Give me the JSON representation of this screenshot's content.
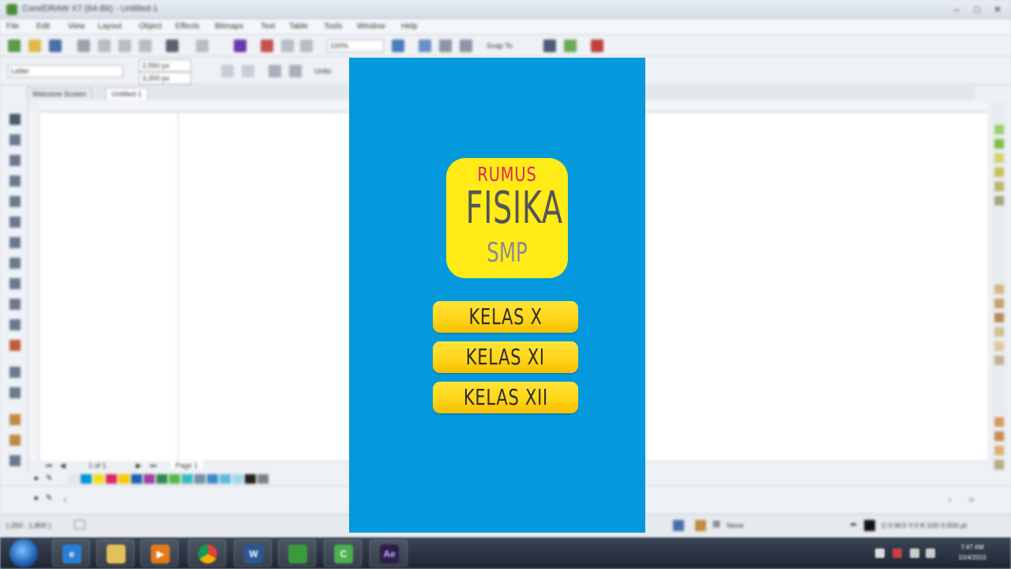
{
  "window": {
    "title": "CorelDRAW X7 (64-Bit) - Untitled-1"
  },
  "menu": [
    "File",
    "Edit",
    "View",
    "Layout",
    "Object",
    "Effects",
    "Bitmaps",
    "Text",
    "Table",
    "Tools",
    "Window",
    "Help"
  ],
  "toolbar": {
    "zoom_value": "100%",
    "snap_to_label": "Snap To"
  },
  "property_bar": {
    "page_size": "Letter",
    "width": "2,550 px",
    "height": "3,300 px",
    "units_label": "Units:"
  },
  "doc_tabs": [
    "Welcome Screen",
    "Untitled-1"
  ],
  "page_nav": {
    "page_count": "1 of 1",
    "page_tab": "Page 1"
  },
  "status": {
    "cursor_position": "(-250 , 1,800 )",
    "fill_label": "None",
    "color_info": "C:0 M:0 Y:0 K:100  0.500 pt"
  },
  "app_screen": {
    "logo": {
      "line1": "RUMUS",
      "line2": "FISIKA",
      "line3": "SMP"
    },
    "buttons": [
      "KELAS X",
      "KELAS XI",
      "KELAS XII"
    ],
    "colors": {
      "background": "#0399dc",
      "logo_tile": "#ffeb16",
      "rumus_text": "#e0245e",
      "fisika_text": "#53545b",
      "smp_text": "#8a8b93",
      "button": "#ffd51a"
    }
  },
  "taskbar": {
    "icons": [
      "internet-explorer-icon",
      "file-explorer-icon",
      "media-player-icon",
      "chrome-icon",
      "word-icon",
      "coreldraw-icon",
      "camtasia-icon",
      "after-effects-icon"
    ],
    "clock_time": "7:47 AM",
    "clock_date": "10/4/2015"
  }
}
